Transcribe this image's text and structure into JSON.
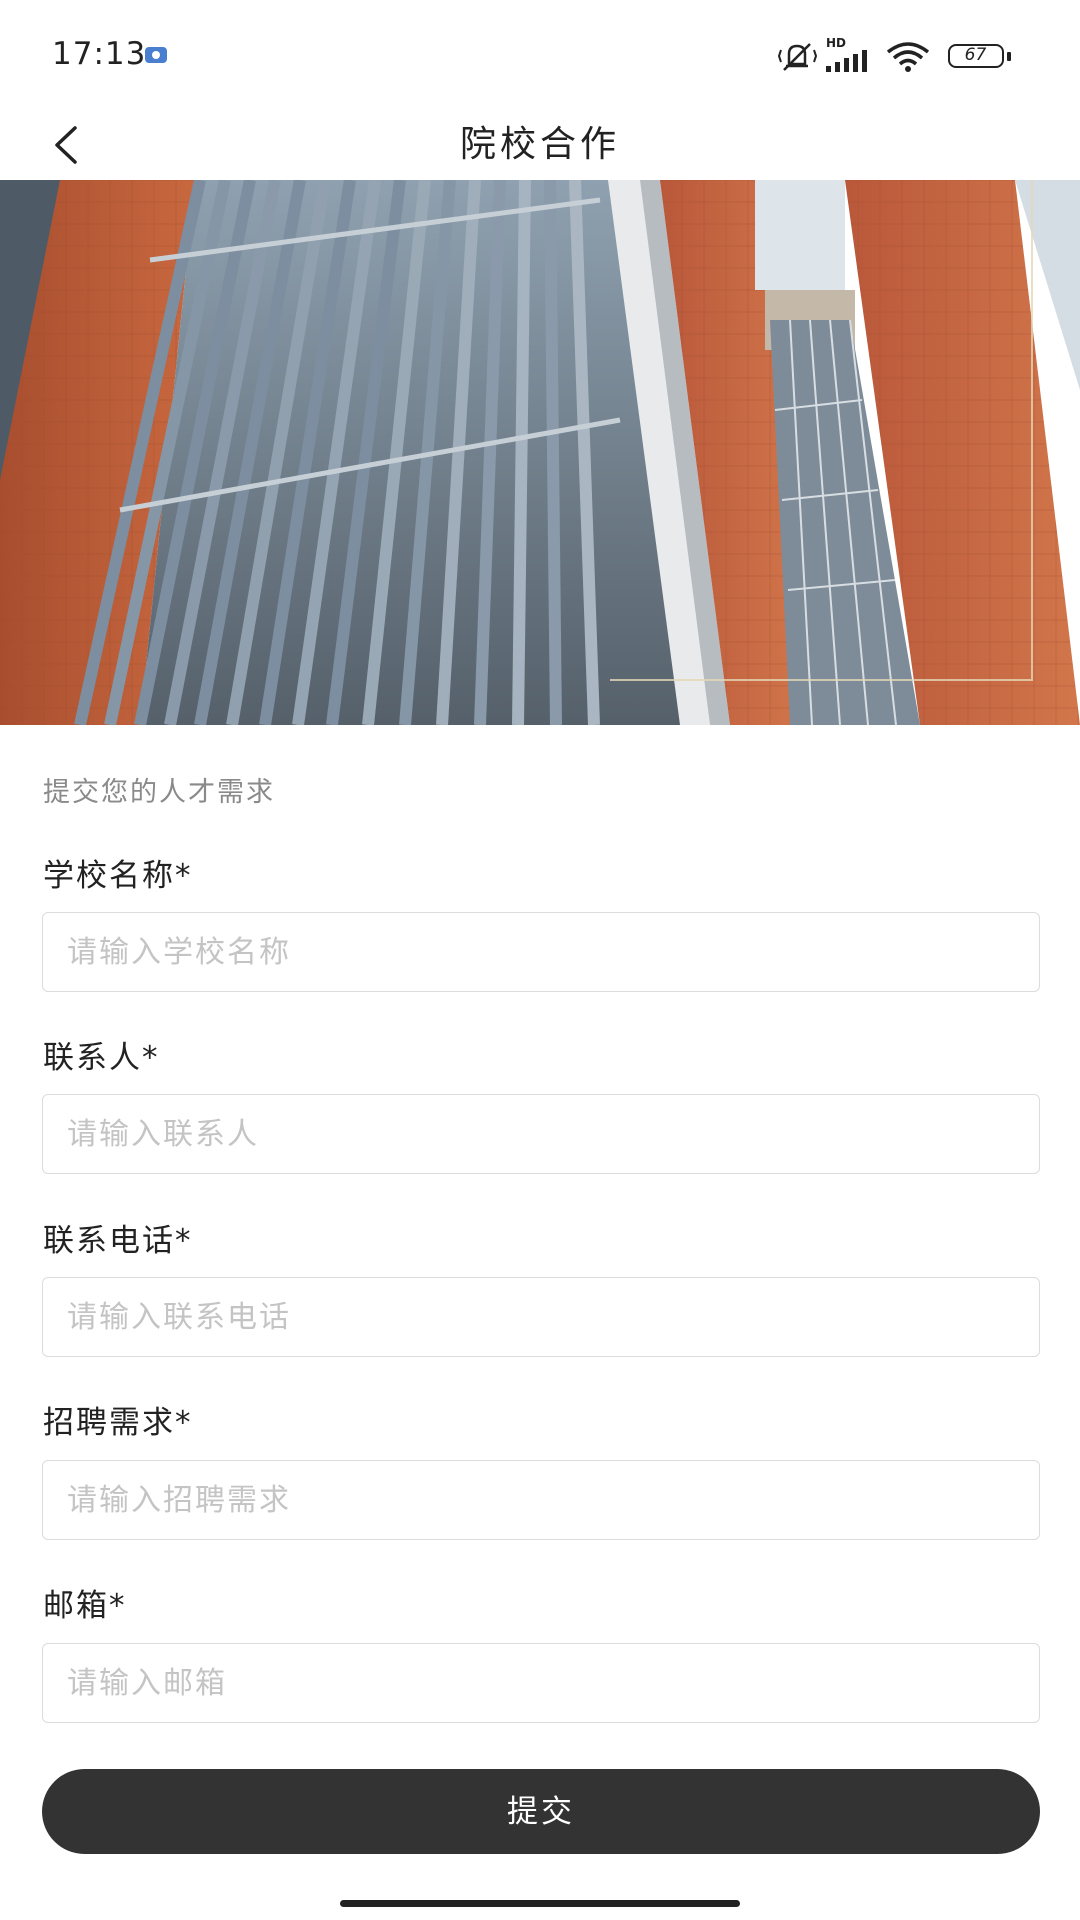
{
  "status_bar": {
    "time": "17:13",
    "network_label": "HD",
    "battery_level": "67",
    "icons": [
      "mute-vibrate-icon",
      "signal-icon",
      "wifi-icon",
      "battery-icon"
    ]
  },
  "header": {
    "title": "院校合作",
    "back_icon": "chevron-left-icon"
  },
  "banner": {
    "description_colors": {
      "brick": "#c4653f",
      "louver": "#6f8396",
      "sky": "#dde4ea"
    }
  },
  "form": {
    "subtitle": "提交您的人才需求",
    "fields": [
      {
        "label": "学校名称*",
        "placeholder": "请输入学校名称",
        "value": ""
      },
      {
        "label": "联系人*",
        "placeholder": "请输入联系人",
        "value": ""
      },
      {
        "label": "联系电话*",
        "placeholder": "请输入联系电话",
        "value": ""
      },
      {
        "label": "招聘需求*",
        "placeholder": "请输入招聘需求",
        "value": ""
      },
      {
        "label": "邮箱*",
        "placeholder": "请输入邮箱",
        "value": ""
      }
    ],
    "submit_label": "提交"
  },
  "theme": {
    "button_color": "#333333",
    "border_color": "#dcdcdc",
    "placeholder_color": "#c4c4c4"
  }
}
